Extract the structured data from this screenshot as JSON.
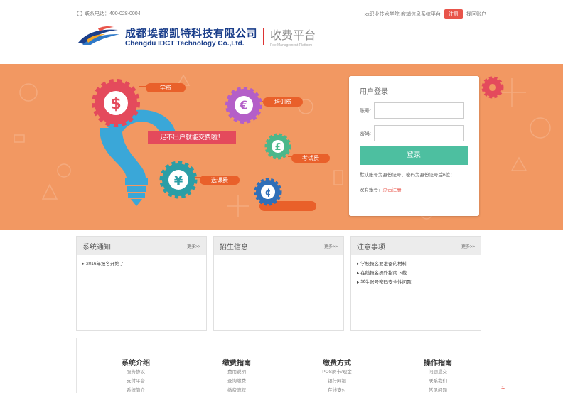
{
  "topbar": {
    "phone": "联系电话：400-028-0004",
    "promo": "xx职业技术学院-教辅信息系统平台",
    "register_label": "注册",
    "account_label": "找回账户"
  },
  "brand": {
    "name_cn": "成都埃都凯特科技有限公司",
    "name_en": "Chengdu IDCT Technology Co.,Ltd.",
    "platform_cn": "收费平台",
    "platform_en": "Fee Management Platform"
  },
  "banner": {
    "tags": [
      "学费",
      "培训费",
      "考试费",
      "选课费"
    ],
    "slogan": "足不出户就能交费啦！",
    "coin_symbols": [
      "$",
      "€",
      "£",
      "¥",
      "¢"
    ]
  },
  "login": {
    "title": "用户登录",
    "account_label": "账号:",
    "password_label": "密码:",
    "account_value": "",
    "password_value": "",
    "submit_label": "登录",
    "hint": "默认账号为身份证号，密码为身份证号后6位！",
    "no_account": "没有账号？",
    "register_link": "点击注册"
  },
  "panels": [
    {
      "title": "系统通知",
      "more": "更多>>",
      "items": [
        "2016年报名开始了"
      ]
    },
    {
      "title": "招生信息",
      "more": "更多>>",
      "items": []
    },
    {
      "title": "注意事项",
      "more": "更多>>",
      "items": [
        "学校报名要准备的材料",
        "在线报名操作指南下载",
        "学生账号密码安全性问题"
      ]
    }
  ],
  "footer": [
    {
      "heading": "系统介绍",
      "links": [
        "服务协议",
        "支付平台",
        "系统简介"
      ]
    },
    {
      "heading": "缴费指南",
      "links": [
        "费用说明",
        "查询缴费",
        "缴费流程"
      ]
    },
    {
      "heading": "缴费方式",
      "links": [
        "POS刷卡/现金",
        "银行网银",
        "在线支付"
      ]
    },
    {
      "heading": "操作指南",
      "links": [
        "问题提交",
        "联系我们",
        "常见问题"
      ]
    }
  ],
  "colors": {
    "accent": "#e8544a",
    "banner": "#f29862",
    "button": "#4dbfa0",
    "brand": "#1b3f8b"
  }
}
